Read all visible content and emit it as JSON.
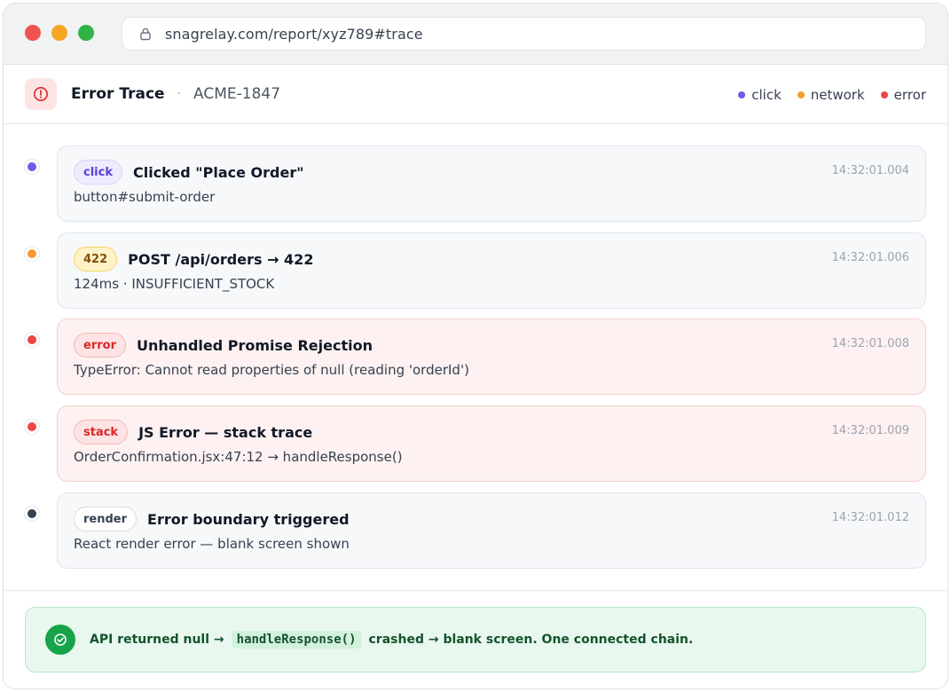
{
  "browser": {
    "url": "snagrelay.com/report/xyz789#trace"
  },
  "header": {
    "title": "Error Trace",
    "separator": "·",
    "issue_id": "ACME-1847",
    "legend": [
      {
        "label": "click",
        "color": "#6d5ce8"
      },
      {
        "label": "network",
        "color": "#f59e2e"
      },
      {
        "label": "error",
        "color": "#ef4444"
      }
    ]
  },
  "events": [
    {
      "badge": "click",
      "title": "Clicked \"Place Order\"",
      "detail": "button#submit-order",
      "time": "14:32:01.004",
      "dot_color": "#6d5ce8"
    },
    {
      "badge": "422",
      "title": "POST /api/orders → 422",
      "detail": "124ms · INSUFFICIENT_STOCK",
      "time": "14:32:01.006",
      "dot_color": "#f59e2e"
    },
    {
      "badge": "error",
      "title": "Unhandled Promise Rejection",
      "detail": "TypeError: Cannot read properties of null (reading 'orderId')",
      "time": "14:32:01.008",
      "dot_color": "#ef4444"
    },
    {
      "badge": "stack",
      "title": "JS Error — stack trace",
      "detail": "OrderConfirmation.jsx:47:12 → handleResponse()",
      "time": "14:32:01.009",
      "dot_color": "#ef4444"
    },
    {
      "badge": "render",
      "title": "Error boundary triggered",
      "detail": "React render error — blank screen shown",
      "time": "14:32:01.012",
      "dot_color": "#334155"
    }
  ],
  "summary": {
    "before": "API returned null →",
    "code": "handleResponse()",
    "after": "crashed → blank screen. One connected chain."
  }
}
